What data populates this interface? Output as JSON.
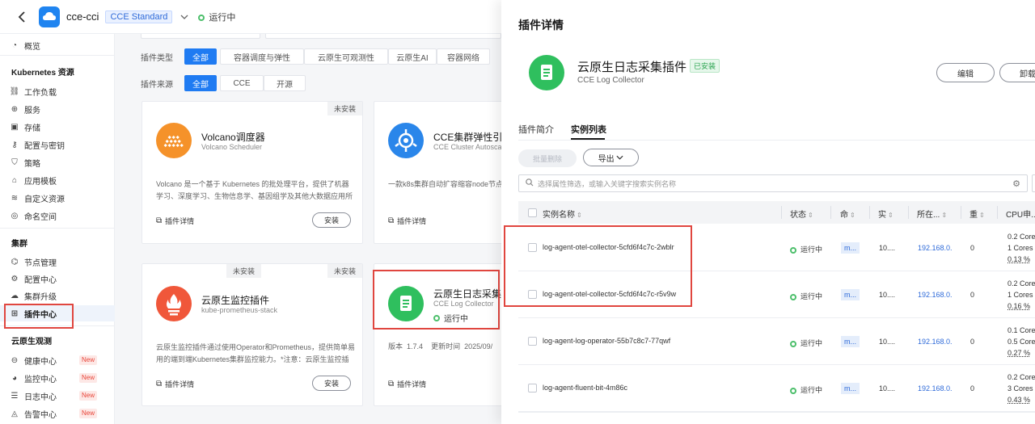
{
  "header": {
    "cluster_name": "cce-cci",
    "edition_tag": "CCE Standard",
    "status": "运行中"
  },
  "sidebar": {
    "overview": "概览",
    "groups": {
      "k8s": "Kubernetes 资源",
      "cluster": "集群",
      "obs": "云原生观测"
    },
    "k8s_items": [
      "工作负载",
      "服务",
      "存储",
      "配置与密钥",
      "策略",
      "应用模板",
      "自定义资源",
      "命名空间"
    ],
    "cluster_items": [
      "节点管理",
      "配置中心",
      "集群升级",
      "插件中心"
    ],
    "obs_items": [
      "健康中心",
      "监控中心",
      "日志中心",
      "告警中心"
    ],
    "new_badge": "New"
  },
  "filters": {
    "type_label": "插件类型",
    "type_options": [
      "全部",
      "容器调度与弹性",
      "云原生可观测性",
      "云原生AI",
      "容器网络"
    ],
    "source_label": "插件来源",
    "source_options": [
      "全部",
      "CCE",
      "开源"
    ]
  },
  "cards": {
    "uninstalled": "未安装",
    "detail": "插件详情",
    "install": "安装",
    "volcano": {
      "title": "Volcano调度器",
      "sub": "Volcano Scheduler",
      "desc1": "Volcano 是一个基于 Kubernetes 的批处理平台，提供了机器",
      "desc2": "学习、深度学习、生物信息学、基因组学及其他大数据应用所"
    },
    "autoscaler": {
      "title": "CCE集群弹性引擎",
      "sub": "CCE Cluster Autosca",
      "desc1": "一款k8s集群自动扩容缩容node节点"
    },
    "prometheus": {
      "title": "云原生监控插件",
      "sub": "kube-prometheus-stack",
      "desc1": "云原生监控插件通过使用Operator和Prometheus，提供简单易",
      "desc2": "用的端到端Kubernetes集群监控能力。*注意：云原生监控插"
    },
    "logcollector": {
      "title": "云原生日志采集插",
      "sub": "CCE Log Collector",
      "status": "运行中",
      "version_label": "版本",
      "version": "1.7.4",
      "updated_label": "更新时间",
      "updated": "2025/09/"
    }
  },
  "panel": {
    "title": "插件详情",
    "name": "云原生日志采集插件",
    "installed": "已安装",
    "name_en": "CCE Log Collector",
    "edit": "编辑",
    "uninstall": "卸载",
    "tabs": [
      "插件简介",
      "实例列表"
    ],
    "batch_delete": "批量删除",
    "export": "导出",
    "search_placeholder": "选择属性筛选，或输入关键字搜索实例名称",
    "columns": [
      "实例名称",
      "状态",
      "命",
      "实",
      "所在...",
      "重",
      "CPU申..."
    ],
    "rows": [
      {
        "name": "log-agent-otel-collector-5cfd6f4c7c-2wblr",
        "status": "运行中",
        "ns": "m...",
        "inst": "10....",
        "node": "192.168.0.",
        "restarts": "0",
        "cpu1": "0.2 Core",
        "cpu2": "1 Cores",
        "cpu3": "0.13 %"
      },
      {
        "name": "log-agent-otel-collector-5cfd6f4c7c-r5v9w",
        "status": "运行中",
        "ns": "m...",
        "inst": "10....",
        "node": "192.168.0.",
        "restarts": "0",
        "cpu1": "0.2 Core",
        "cpu2": "1 Cores",
        "cpu3": "0.16 %"
      },
      {
        "name": "log-agent-log-operator-55b7c8c7-77qwf",
        "status": "运行中",
        "ns": "m...",
        "inst": "10....",
        "node": "192.168.0.",
        "restarts": "0",
        "cpu1": "0.1 Core",
        "cpu2": "0.5 Core",
        "cpu3": "0.27 %"
      },
      {
        "name": "log-agent-fluent-bit-4m86c",
        "status": "运行中",
        "ns": "m...",
        "inst": "10....",
        "node": "192.168.0.",
        "restarts": "0",
        "cpu1": "0.2 Core",
        "cpu2": "3 Cores",
        "cpu3": "0.43 %"
      }
    ]
  },
  "colors": {
    "accent": "#1f7bf2",
    "running": "#4cbf6b",
    "highlight": "#e0463f"
  }
}
